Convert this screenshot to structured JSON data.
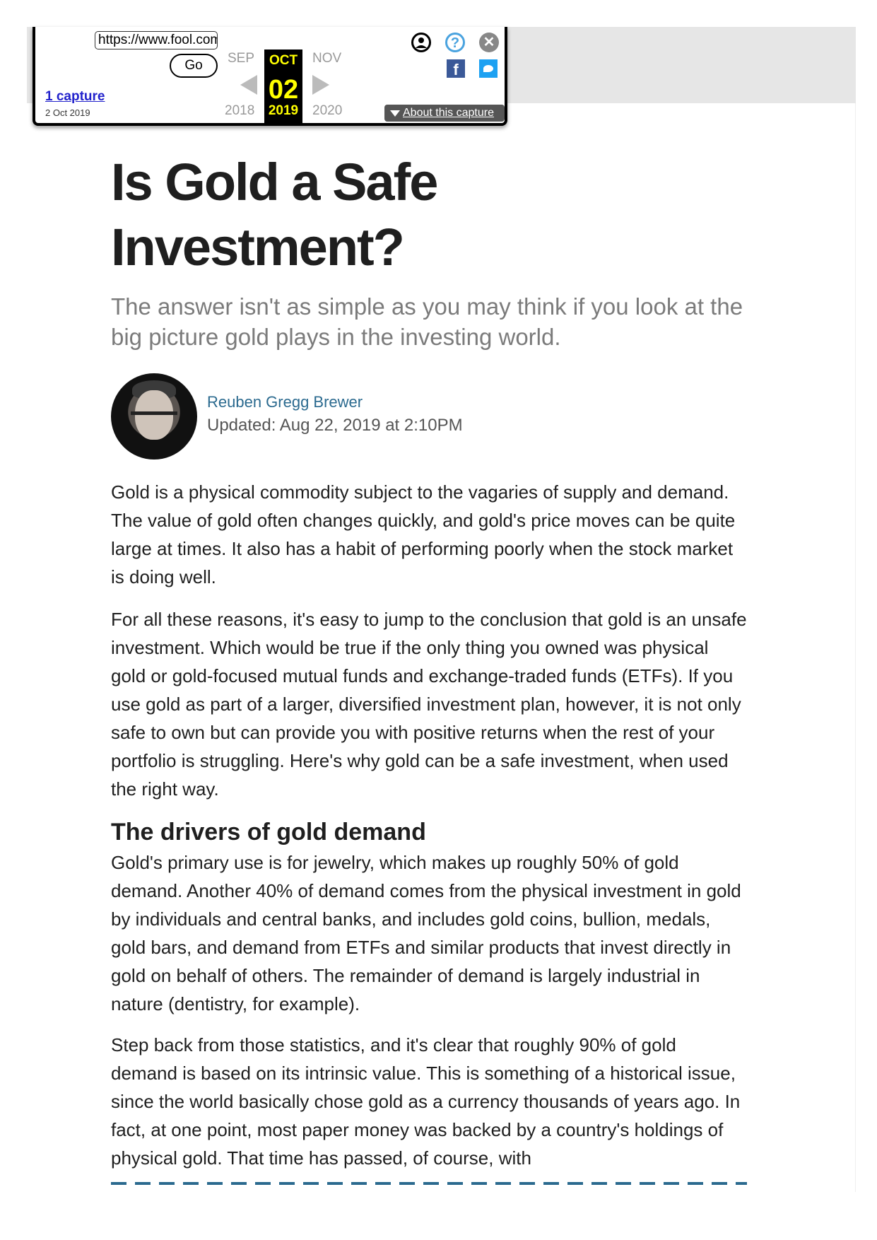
{
  "wayback": {
    "url_value": "https://www.fool.com",
    "go_label": "Go",
    "captures_label": "1 capture",
    "capture_date": "2 Oct 2019",
    "prev_month": "SEP",
    "current_month": "OCT",
    "next_month": "NOV",
    "current_day": "02",
    "prev_year": "2018",
    "current_year": "2019",
    "next_year": "2020",
    "help_glyph": "?",
    "close_glyph": "✕",
    "facebook_glyph": "f",
    "about_label": "About this capture"
  },
  "article": {
    "title": "Is Gold a Safe Investment?",
    "subtitle": "The answer isn't as simple as you may think if you look at the big picture gold plays in the investing world.",
    "author": "Reuben Gregg Brewer",
    "updated": "Updated: Aug 22, 2019 at 2:10PM",
    "paragraphs": [
      "Gold is a physical commodity subject to the vagaries of supply and demand. The value of gold often changes quickly, and gold's price moves can be quite large at times. It also has a habit of performing poorly when the stock market is doing well.",
      "For all these reasons, it's easy to jump to the conclusion that gold is an unsafe investment. Which would be true if the only thing you owned was physical gold or gold-focused mutual funds and exchange-traded funds (ETFs). If you use gold as part of a larger, diversified investment plan, however, it is not only safe to own but can provide you with positive returns when the rest of your portfolio is struggling. Here's why gold can be a safe investment, when used the right way.",
      "Gold's primary use is for jewelry, which makes up roughly 50% of gold demand. Another 40% of demand comes from the physical investment in gold by individuals and central banks, and includes gold coins, bullion, medals, gold bars, and demand from ETFs and similar products that invest directly in gold on behalf of others. The remainder of demand is largely industrial in nature (dentistry, for example).",
      "Step back from those statistics, and it's clear that roughly 90% of gold demand is based on its intrinsic value. This is something of a historical issue, since the world basically chose gold as a currency thousands of years ago. In fact, at one point, most paper money was backed by a country's holdings of physical gold. That time has passed, of course, with"
    ],
    "section_heading": "The drivers of gold demand"
  },
  "colors": {
    "link": "#2b6a8f",
    "capture_link": "#2222cc",
    "calendar_highlight": "#ffff00",
    "subtitle": "#7b7b7b"
  }
}
